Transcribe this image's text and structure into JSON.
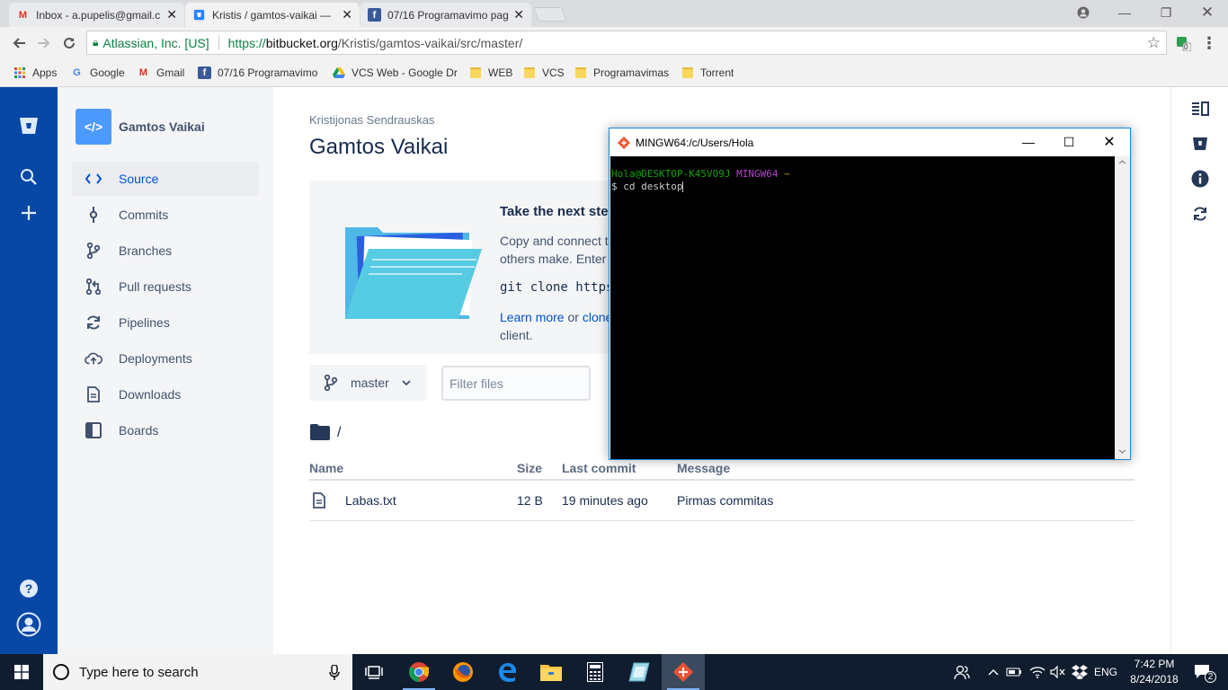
{
  "browser": {
    "tabs": [
      {
        "label": "Inbox - a.pupelis@gmail.c",
        "icon": "gmail-icon"
      },
      {
        "label": "Kristis / gamtos-vaikai —",
        "icon": "bitbucket-icon"
      },
      {
        "label": "07/16 Programavimo pag",
        "icon": "facebook-icon"
      }
    ],
    "site_identity": "Atlassian, Inc. [US]",
    "url_scheme": "https://",
    "url_host": "bitbucket.org",
    "url_path": "/Kristis/gamtos-vaikai/src/master/",
    "extension_badge": "0"
  },
  "bookmarks": [
    {
      "label": "Apps"
    },
    {
      "label": "Google"
    },
    {
      "label": "Gmail"
    },
    {
      "label": "07/16 Programavimo"
    },
    {
      "label": "VCS Web - Google Dr"
    },
    {
      "label": "WEB"
    },
    {
      "label": "VCS"
    },
    {
      "label": "Programavimas"
    },
    {
      "label": "Torrent"
    }
  ],
  "sidebar": {
    "repo_name": "Gamtos Vaikai",
    "repo_avatar": "</>",
    "items": [
      {
        "label": "Source",
        "icon": "code-icon"
      },
      {
        "label": "Commits",
        "icon": "commit-icon"
      },
      {
        "label": "Branches",
        "icon": "branch-icon"
      },
      {
        "label": "Pull requests",
        "icon": "pull-request-icon"
      },
      {
        "label": "Pipelines",
        "icon": "pipelines-icon"
      },
      {
        "label": "Deployments",
        "icon": "deployments-icon"
      },
      {
        "label": "Downloads",
        "icon": "downloads-icon"
      },
      {
        "label": "Boards",
        "icon": "boards-icon"
      }
    ]
  },
  "main": {
    "owner": "Kristijonas Sendrauskas",
    "title": "Gamtos Vaikai",
    "onboarding": {
      "heading": "Take the next ste",
      "line1": "Copy and connect t",
      "line2": "others make. Enter g",
      "clone_cmd": "git clone https:",
      "learn_more": "Learn more",
      "or": "or",
      "clone_link": "clone",
      "client": "client."
    },
    "branch": "master",
    "filter_placeholder": "Filter files",
    "path": "/",
    "table": {
      "headers": [
        "Name",
        "Size",
        "Last commit",
        "Message"
      ],
      "rows": [
        {
          "name": "Labas.txt",
          "size": "12 B",
          "last_commit": "19 minutes ago",
          "message": "Pirmas commitas"
        }
      ]
    }
  },
  "terminal": {
    "title": "MINGW64:/c/Users/Hola",
    "prompt_user": "Hola@DESKTOP-K45VO9J",
    "prompt_env": "MINGW64",
    "prompt_dir": "~",
    "command": "$ cd desktop"
  },
  "taskbar": {
    "search_placeholder": "Type here to search",
    "language": "ENG",
    "time": "7:42 PM",
    "date": "8/24/2018",
    "notifications": "2"
  },
  "colors": {
    "bitbucket_blue": "#0747a6",
    "link_blue": "#0052cc",
    "terminal_green": "#13a10e",
    "terminal_magenta": "#b148c6",
    "terminal_yellow": "#c19c00"
  }
}
